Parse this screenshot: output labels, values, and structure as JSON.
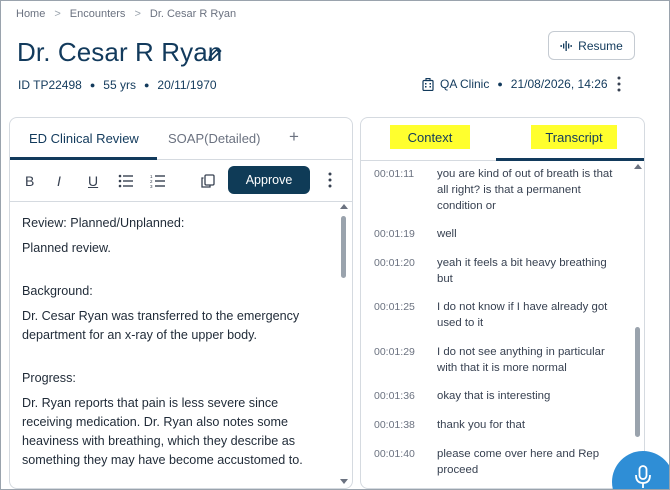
{
  "breadcrumb": [
    "Home",
    "Encounters",
    "Dr. Cesar R Ryan"
  ],
  "patient": {
    "name": "Dr. Cesar R Ryan",
    "id": "ID TP22498",
    "age": "55 yrs",
    "dob": "20/11/1970",
    "clinic": "QA Clinic",
    "datetime": "21/08/2026, 14:26"
  },
  "header": {
    "resume_label": "Resume"
  },
  "note_tabs": {
    "tabs": [
      "ED Clinical Review",
      "SOAP(Detailed)"
    ],
    "active": 0,
    "add_label": "+"
  },
  "toolbar": {
    "bold": "B",
    "italic": "I",
    "underline": "U",
    "approve_label": "Approve"
  },
  "editor": {
    "review_heading": "Review: Planned/Unplanned:",
    "review_text": "Planned review.",
    "background_heading": "Background:",
    "background_text": "Dr. Cesar Ryan was transferred to the emergency department for an x-ray of the upper body.",
    "progress_heading": "Progress:",
    "progress_text": "Dr. Ryan reports that pain is less severe since receiving medication. Dr. Ryan also notes some heaviness with breathing, which they describe as something they may have become accustomed to."
  },
  "context_tabs": {
    "tabs": [
      "Context",
      "Transcript"
    ],
    "active": 1
  },
  "transcript": [
    {
      "time": "00:01:11",
      "text": "you are kind of out of breath is that all right? is that a permanent condition or"
    },
    {
      "time": "00:01:19",
      "text": "well"
    },
    {
      "time": "00:01:20",
      "text": "yeah it feels a bit heavy breathing but"
    },
    {
      "time": "00:01:25",
      "text": "I do not know if I have already got used to it"
    },
    {
      "time": "00:01:29",
      "text": "I do not see anything in particular with that it is more normal"
    },
    {
      "time": "00:01:36",
      "text": "okay that is interesting"
    },
    {
      "time": "00:01:38",
      "text": "thank you for that"
    },
    {
      "time": "00:01:40",
      "text": "please come over here and Rep proceed"
    }
  ],
  "colors": {
    "primary": "#0f3b57",
    "highlight": "#ffff2e",
    "fab": "#2f8ed6"
  }
}
